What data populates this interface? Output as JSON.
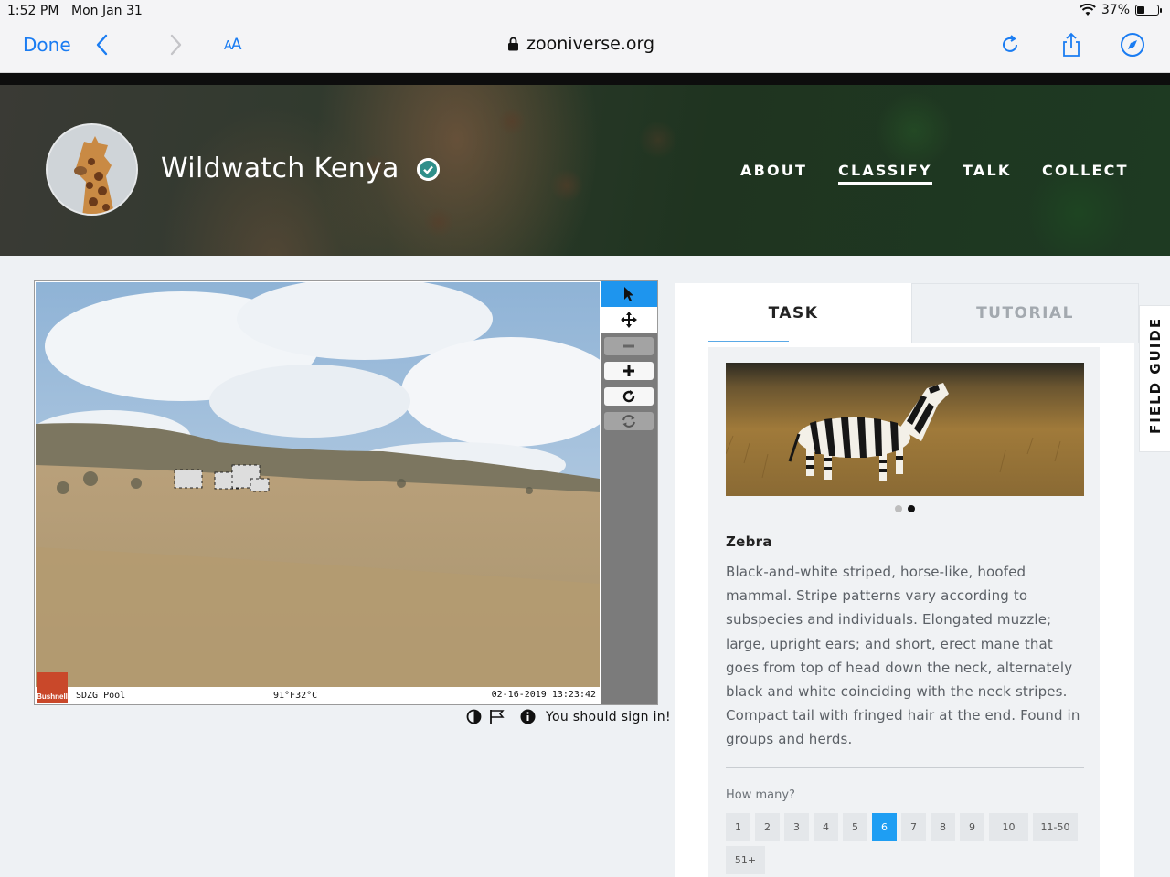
{
  "status": {
    "time": "1:52 PM",
    "date": "Mon Jan 31",
    "battery": "37%",
    "battery_level": 0.37
  },
  "browser": {
    "done_label": "Done",
    "text_size_label": "AA",
    "url": "zooniverse.org"
  },
  "project": {
    "title": "Wildwatch Kenya",
    "nav": [
      {
        "label": "ABOUT"
      },
      {
        "label": "CLASSIFY"
      },
      {
        "label": "TALK"
      },
      {
        "label": "COLLECT"
      }
    ]
  },
  "viewer": {
    "camera_id": "SDZG Pool",
    "temperature": "91°F32°C",
    "timestamp": "02-16-2019 13:23:42",
    "brand": "Bushnell",
    "sign_in_note": "You should sign in!"
  },
  "task_panel": {
    "tabs": [
      {
        "label": "TASK"
      },
      {
        "label": "TUTORIAL"
      }
    ],
    "species_name": "Zebra",
    "species_description": "Black-and-white striped, horse-like, hoofed mammal. Stripe patterns vary according to subspecies and individuals. Elongated muzzle; large, upright ears; and short, erect mane that goes from top of head down the neck, alternately black and white coinciding with the neck stripes. Compact tail with fringed hair at the end. Found in groups and herds.",
    "how_many_label": "How many?",
    "counts": [
      "1",
      "2",
      "3",
      "4",
      "5",
      "6",
      "7",
      "8",
      "9",
      "10",
      "11-50",
      "51+"
    ],
    "selected_count": "6"
  },
  "field_guide_label": "FIELD GUIDE",
  "colors": {
    "accent": "#1e9ef3",
    "safari_blue": "#1a7cf2",
    "verified_teal": "#2f8f8a"
  }
}
